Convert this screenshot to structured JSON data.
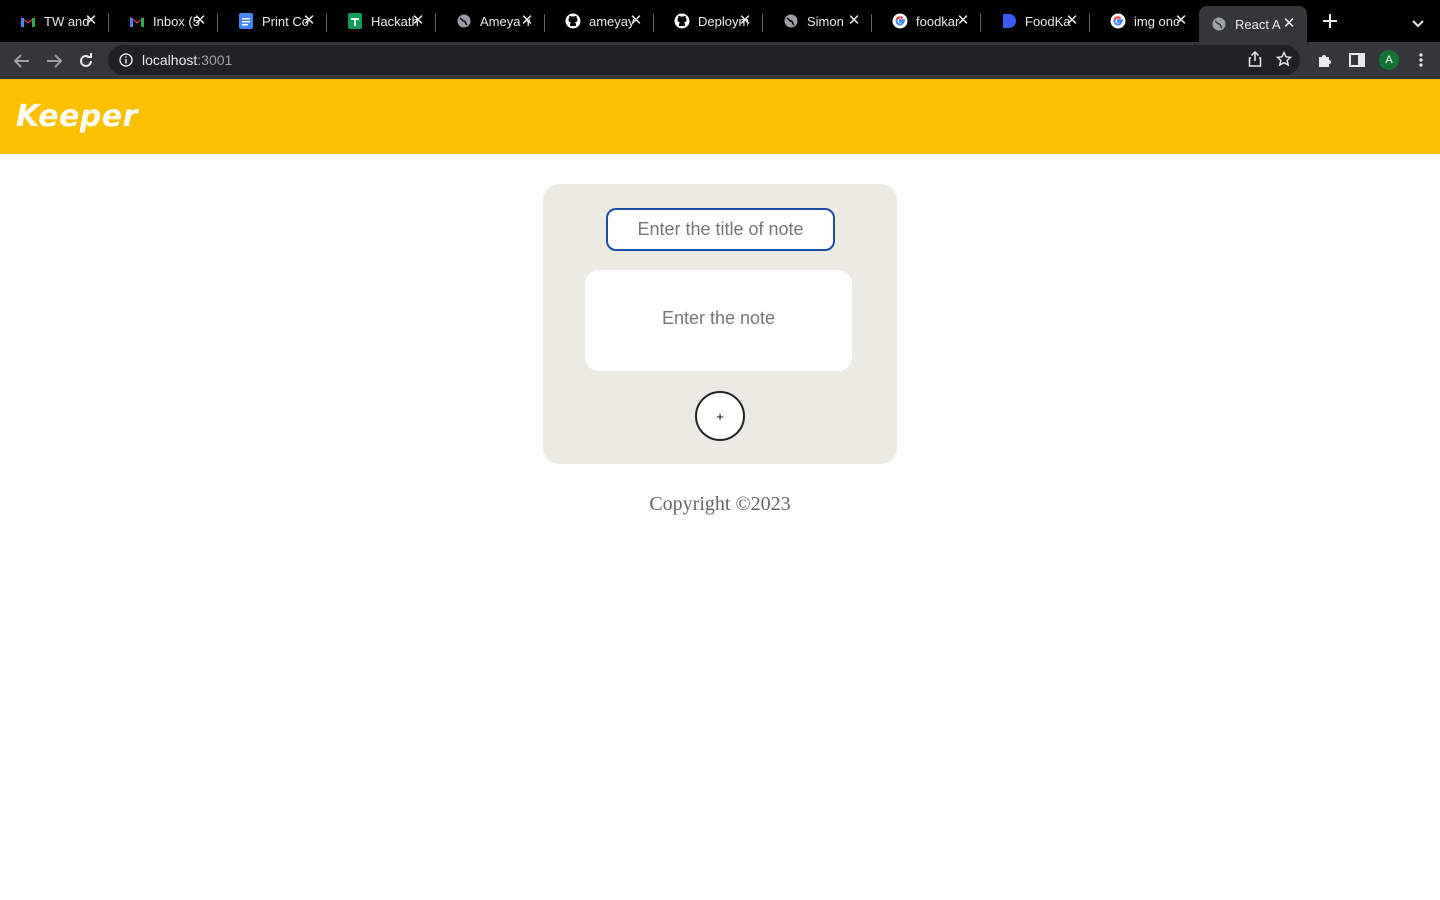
{
  "browser": {
    "tabs": [
      {
        "title": "TW and",
        "icon": "gmail-icon"
      },
      {
        "title": "Inbox (5",
        "icon": "gmail-icon"
      },
      {
        "title": "Print Co",
        "icon": "google-docs-icon"
      },
      {
        "title": "Hackath",
        "icon": "google-sheets-icon"
      },
      {
        "title": "Ameya Y",
        "icon": "globe-icon"
      },
      {
        "title": "ameyay",
        "icon": "github-icon"
      },
      {
        "title": "Deploym",
        "icon": "github-icon"
      },
      {
        "title": "Simon",
        "icon": "globe-icon"
      },
      {
        "title": "foodkar",
        "icon": "google-icon"
      },
      {
        "title": "FoodKa",
        "icon": "app-icon"
      },
      {
        "title": "img onc",
        "icon": "google-icon"
      },
      {
        "title": "React A",
        "icon": "globe-icon",
        "active": true
      }
    ],
    "url": {
      "host": "localhost",
      "port": ":3001"
    },
    "profile_initial": "A"
  },
  "app": {
    "title": "Keeper",
    "colors": {
      "header": "#fbc000",
      "card": "#ebebe4"
    }
  },
  "form": {
    "title_placeholder": "Enter the title of note",
    "note_placeholder": "Enter the note",
    "add_label": "+"
  },
  "footer": {
    "text": "Copyright ©2023"
  }
}
